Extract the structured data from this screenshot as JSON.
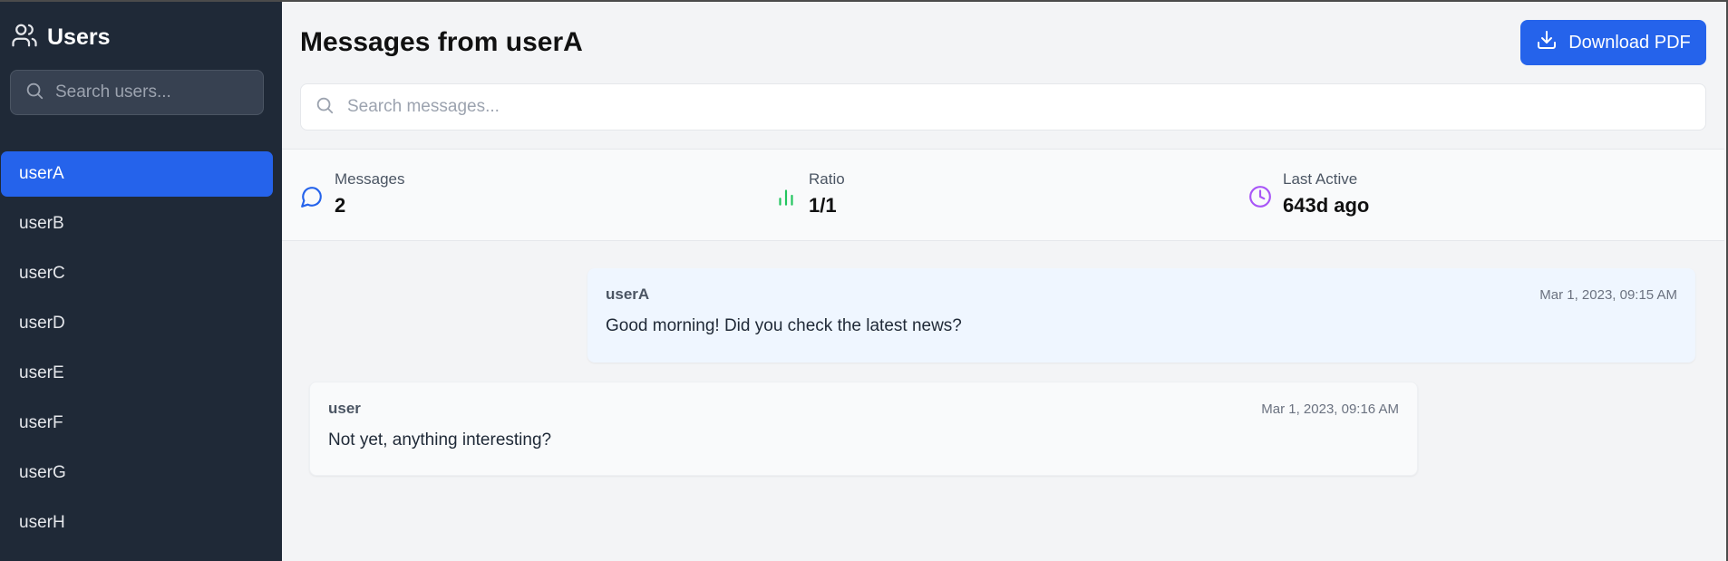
{
  "sidebar": {
    "title": "Users",
    "search_placeholder": "Search users...",
    "users": [
      "userA",
      "userB",
      "userC",
      "userD",
      "userE",
      "userF",
      "userG",
      "userH"
    ],
    "active_user": "userA"
  },
  "header": {
    "title": "Messages from userA",
    "download_label": "Download PDF"
  },
  "search": {
    "placeholder": "Search messages..."
  },
  "stats": {
    "messages": {
      "label": "Messages",
      "value": "2"
    },
    "ratio": {
      "label": "Ratio",
      "value": "1/1"
    },
    "last_active": {
      "label": "Last Active",
      "value": "643d ago"
    }
  },
  "messages": [
    {
      "sender": "userA",
      "time": "Mar 1, 2023, 09:15 AM",
      "text": "Good morning! Did you check the latest news?"
    },
    {
      "sender": "user",
      "time": "Mar 1, 2023, 09:16 AM",
      "text": "Not yet, anything interesting?"
    }
  ],
  "colors": {
    "sidebar_bg": "#1f2937",
    "accent": "#2563eb",
    "messages_icon": "#2563eb",
    "ratio_icon": "#22c55e",
    "last_active_icon": "#a855f7"
  },
  "icons": {
    "sidebar_header": "users-icon",
    "search": "search-icon",
    "download": "download-icon",
    "messages": "message-circle-icon",
    "ratio": "bar-chart-icon",
    "last_active": "clock-icon"
  }
}
